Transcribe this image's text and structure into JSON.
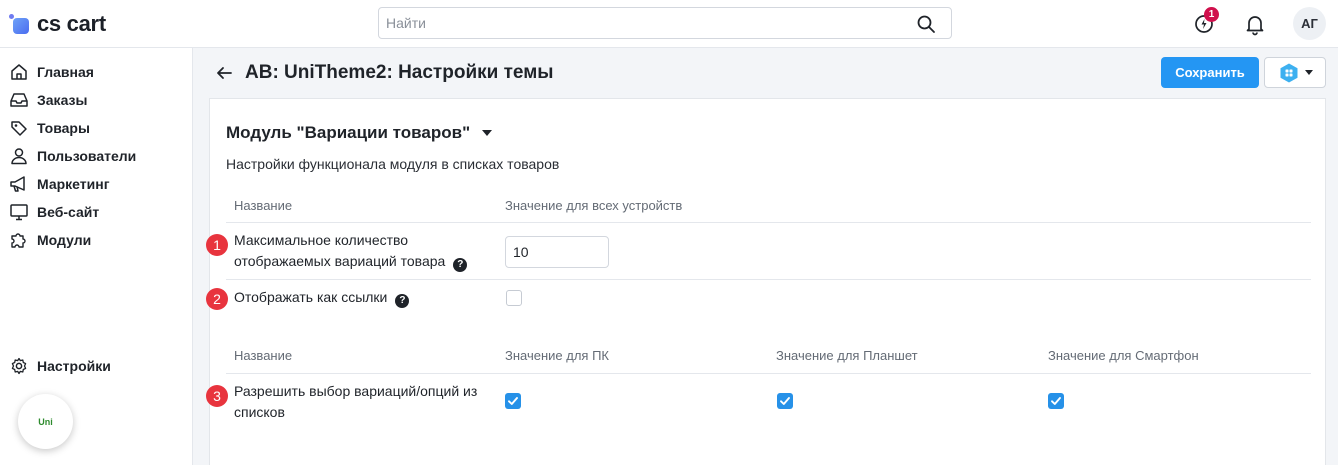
{
  "brand": {
    "logo_text": "cs cart"
  },
  "search": {
    "placeholder": "Найти",
    "value": ""
  },
  "topbar": {
    "notification_count": "1",
    "avatar_initials": "АГ"
  },
  "sidebar": {
    "items": [
      {
        "label": "Главная",
        "icon": "home-icon"
      },
      {
        "label": "Заказы",
        "icon": "inbox-icon"
      },
      {
        "label": "Товары",
        "icon": "tag-icon"
      },
      {
        "label": "Пользователи",
        "icon": "user-icon"
      },
      {
        "label": "Маркетинг",
        "icon": "megaphone-icon"
      },
      {
        "label": "Веб-сайт",
        "icon": "monitor-icon"
      },
      {
        "label": "Модули",
        "icon": "puzzle-icon"
      }
    ],
    "settings_label": "Настройки",
    "uni_bubble_label": "Uni"
  },
  "page": {
    "title": "AB: UniTheme2: Настройки темы",
    "save_label": "Сохранить"
  },
  "section": {
    "title": "Модуль \"Вариации товаров\"",
    "description": "Настройки функционала модуля в списках товаров"
  },
  "table1": {
    "col_name": "Название",
    "col_value": "Значение для всех устройств",
    "rows": [
      {
        "marker": "1",
        "label_line1": "Максимальное количество",
        "label_line2": "отображаемых вариаций товара",
        "value": "10"
      },
      {
        "marker": "2",
        "label": "Отображать как ссылки",
        "checked": false
      }
    ]
  },
  "table2": {
    "col_name": "Название",
    "col_pc": "Значение для ПК",
    "col_tablet": "Значение для Планшет",
    "col_phone": "Значение для Смартфон",
    "rows": [
      {
        "marker": "3",
        "label_line1": "Разрешить выбор вариаций/опций из",
        "label_line2": "списков",
        "pc": true,
        "tablet": true,
        "phone": true
      }
    ]
  },
  "colors": {
    "accent": "#2496f3",
    "marker": "#e8343e",
    "badge": "#d0104c",
    "checkbox": "#2691e8"
  }
}
